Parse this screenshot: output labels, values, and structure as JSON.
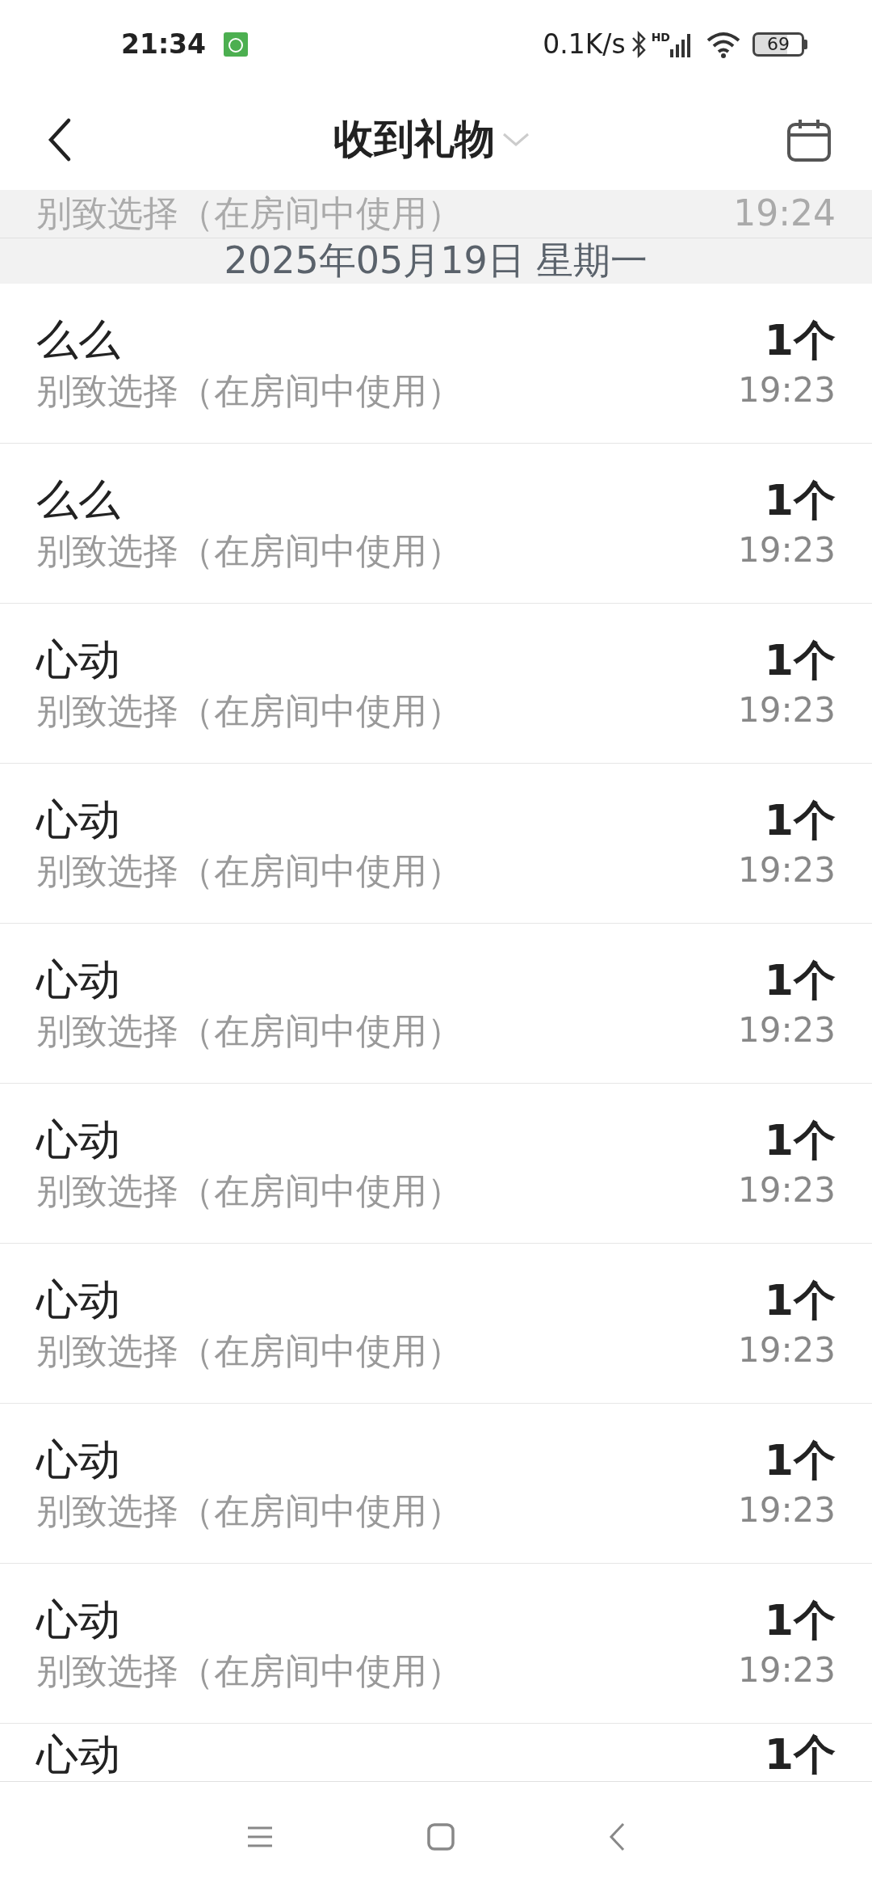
{
  "status_bar": {
    "time": "21:34",
    "net_speed": "0.1K/s",
    "signal_label": "HD",
    "battery": "69"
  },
  "header": {
    "title": "收到礼物"
  },
  "top_partial_row": {
    "subtitle": "别致选择（在房间中使用）",
    "time": "19:24"
  },
  "date_header": "2025年05月19日 星期一",
  "rows": [
    {
      "name": "么么",
      "subtitle": "别致选择（在房间中使用）",
      "count": "1个",
      "time": "19:23"
    },
    {
      "name": "么么",
      "subtitle": "别致选择（在房间中使用）",
      "count": "1个",
      "time": "19:23"
    },
    {
      "name": "心动",
      "subtitle": "别致选择（在房间中使用）",
      "count": "1个",
      "time": "19:23"
    },
    {
      "name": "心动",
      "subtitle": "别致选择（在房间中使用）",
      "count": "1个",
      "time": "19:23"
    },
    {
      "name": "心动",
      "subtitle": "别致选择（在房间中使用）",
      "count": "1个",
      "time": "19:23"
    },
    {
      "name": "心动",
      "subtitle": "别致选择（在房间中使用）",
      "count": "1个",
      "time": "19:23"
    },
    {
      "name": "心动",
      "subtitle": "别致选择（在房间中使用）",
      "count": "1个",
      "time": "19:23"
    },
    {
      "name": "心动",
      "subtitle": "别致选择（在房间中使用）",
      "count": "1个",
      "time": "19:23"
    },
    {
      "name": "心动",
      "subtitle": "别致选择（在房间中使用）",
      "count": "1个",
      "time": "19:23"
    }
  ],
  "bottom_partial_row": {
    "name": "心动",
    "count": "1个"
  }
}
